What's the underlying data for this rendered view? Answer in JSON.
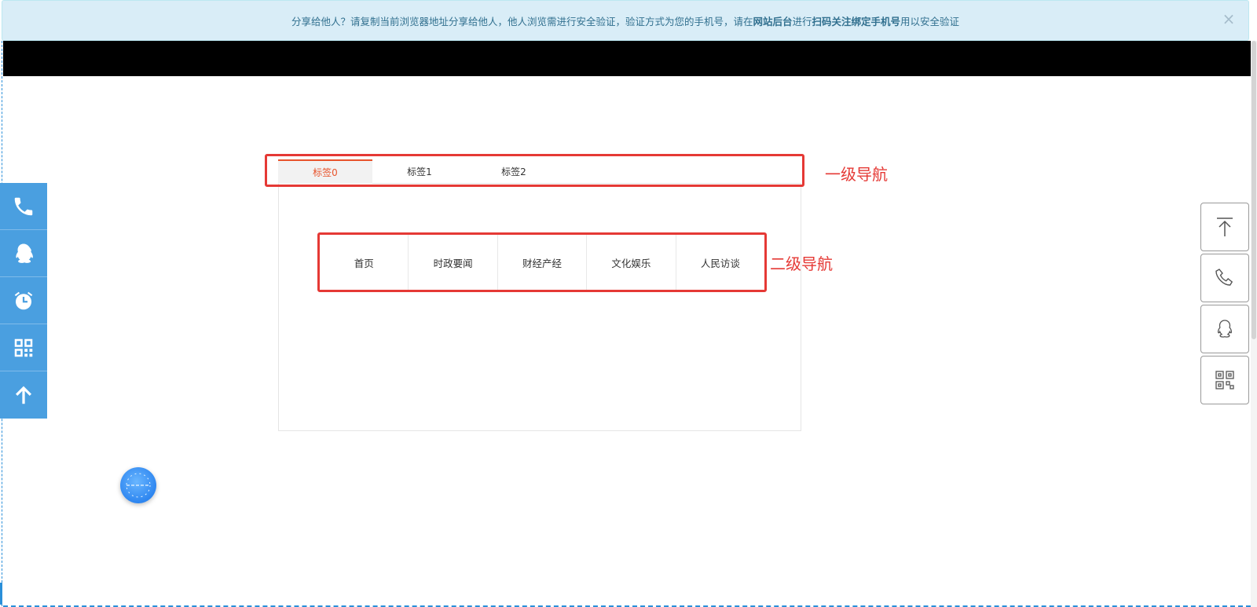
{
  "notice": {
    "text_before": "分享给他人？请复制当前浏览器地址分享给他人，他人浏览需进行安全验证，验证方式为您的手机号，请在",
    "bold_1": "网站后台",
    "text_mid": "进行",
    "bold_2": "扫码关注绑定手机号",
    "text_after": "用以安全验证",
    "close_label": "×"
  },
  "tabs": [
    {
      "label": "标签0",
      "active": true
    },
    {
      "label": "标签1",
      "active": false
    },
    {
      "label": "标签2",
      "active": false
    }
  ],
  "annotations": {
    "primary_nav": "一级导航",
    "secondary_nav": "二级导航"
  },
  "subnav": [
    "首页",
    "时政要闻",
    "财经产经",
    "文化娱乐",
    "人民访谈"
  ],
  "left_bar_icons": [
    "phone-icon",
    "qq-icon",
    "alarm-clock-icon",
    "qr-code-icon",
    "arrow-up-icon"
  ],
  "right_bar_icons": [
    "back-to-top-icon",
    "phone-icon",
    "qq-icon",
    "qr-code-icon"
  ],
  "colors": {
    "accent": "#e8532b",
    "annotation_red": "#e53935",
    "left_bar_blue": "#4a9fe0",
    "notice_bg": "#d9edf7",
    "notice_text": "#31708f"
  }
}
